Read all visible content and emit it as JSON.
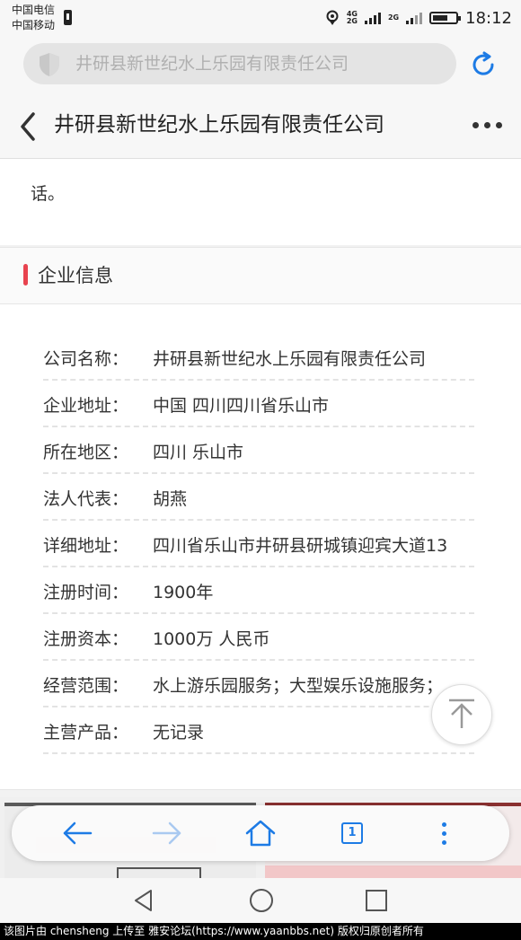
{
  "status_bar": {
    "carrier_1": "中国电信",
    "carrier_2": "中国移动",
    "network_1": "4G",
    "network_2": "2G",
    "time": "18:12"
  },
  "address_bar": {
    "url_text": "井研县新世纪水上乐园有限责任公司",
    "refresh_icon": "refresh-icon"
  },
  "nav": {
    "title": "井研县新世纪水上乐园有限责任公司"
  },
  "content": {
    "trailing_text": "话。",
    "section_title": "企业信息",
    "accent_color": "#e8434f",
    "info_rows": [
      {
        "label": "公司名称：",
        "value": "井研县新世纪水上乐园有限责任公司"
      },
      {
        "label": "企业地址：",
        "value": "中国 四川四川省乐山市"
      },
      {
        "label": "所在地区：",
        "value": "四川  乐山市"
      },
      {
        "label": "法人代表：",
        "value": "胡燕"
      },
      {
        "label": "详细地址：",
        "value": "四川省乐山市井研县研城镇迎宾大道13"
      },
      {
        "label": "注册时间：",
        "value": "1900年"
      },
      {
        "label": "注册资本：",
        "value": "1000万 人民币"
      },
      {
        "label": "经营范围：",
        "value": "水上游乐园服务；大型娱乐设施服务；"
      },
      {
        "label": "主营产品：",
        "value": "无记录"
      }
    ]
  },
  "browser_toolbar": {
    "tab_count": "1",
    "accent_color": "#1d7be5"
  },
  "credit": "该图片由 chensheng 上传至 雅安论坛(https://www.yaanbbs.net) 版权归原创者所有"
}
